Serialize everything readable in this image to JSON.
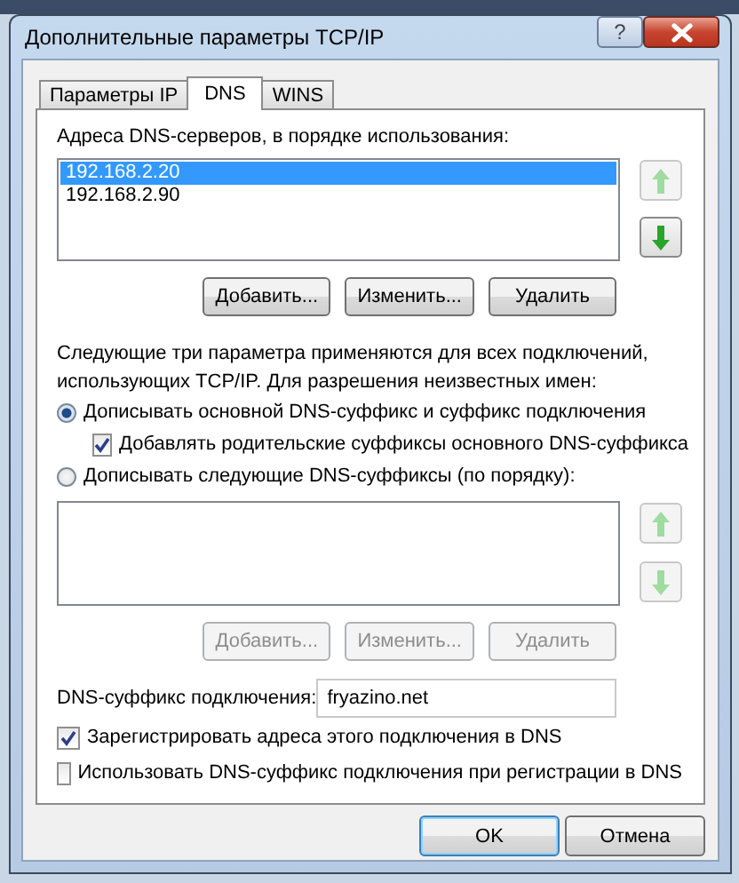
{
  "window": {
    "title": "Дополнительные параметры TCP/IP",
    "help_button": "?"
  },
  "tabs": [
    {
      "label": "Параметры IP",
      "selected": false
    },
    {
      "label": "DNS",
      "selected": true
    },
    {
      "label": "WINS",
      "selected": false
    }
  ],
  "dns_servers": {
    "label": "Адреса DNS-серверов, в порядке использования:",
    "items": [
      {
        "text": "192.168.2.20",
        "selected": true
      },
      {
        "text": "192.168.2.90",
        "selected": false
      }
    ],
    "move_up_disabled": true,
    "move_down_disabled": false,
    "buttons": [
      {
        "label": "Добавить...",
        "disabled": false
      },
      {
        "label": "Изменить...",
        "disabled": false
      },
      {
        "label": "Удалить",
        "disabled": false
      }
    ]
  },
  "description": "Следующие три параметра применяются для всех подключений, использующих TCP/IP. Для разрешения неизвестных имен:",
  "options": [
    {
      "label": "Дописывать основной DNS-суффикс и суффикс подключения",
      "selected": true,
      "children": [
        {
          "label": "Добавлять родительские суффиксы основного DNS-суффикса",
          "checked": true
        }
      ]
    },
    {
      "label": "Дописывать следующие DNS-суффиксы (по порядку):",
      "selected": false
    }
  ],
  "suffix_list": {
    "move_up_disabled": true,
    "move_down_disabled": true,
    "buttons": [
      {
        "label": "Добавить...",
        "disabled": true
      },
      {
        "label": "Изменить...",
        "disabled": true
      },
      {
        "label": "Удалить",
        "disabled": true
      }
    ]
  },
  "connection_suffix": {
    "label": "DNS-суффикс подключения:",
    "value": "fryazino.net"
  },
  "registration": [
    {
      "label": "Зарегистрировать адреса этого подключения в DNS",
      "checked": true
    },
    {
      "label": "Использовать DNS-суффикс подключения при регистрации в DNS",
      "checked": false
    }
  ],
  "footer_buttons": [
    {
      "label": "OK",
      "default": true
    },
    {
      "label": "Отмена",
      "default": false
    }
  ]
}
